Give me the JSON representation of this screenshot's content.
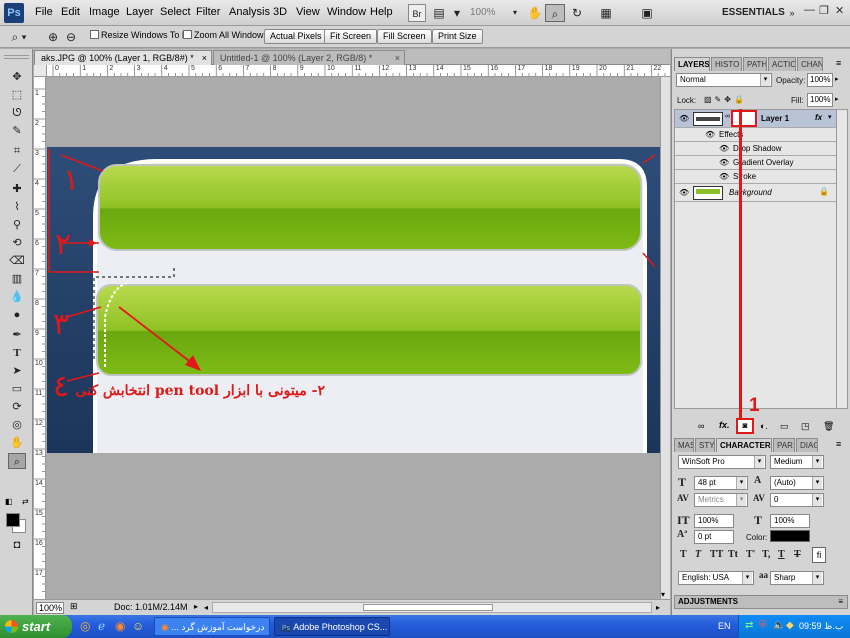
{
  "app": {
    "logo": "Ps"
  },
  "menu": [
    "File",
    "Edit",
    "Image",
    "Layer",
    "Select",
    "Filter",
    "Analysis",
    "3D",
    "View",
    "Window",
    "Help"
  ],
  "menubar": {
    "zoom": "100%",
    "workspace": "ESSENTIALS"
  },
  "options": {
    "resize_windows": "Resize Windows To Fit",
    "zoom_all": "Zoom All Windows",
    "actual_pixels": "Actual Pixels",
    "fit_screen": "Fit Screen",
    "fill_screen": "Fill Screen",
    "print_size": "Print Size"
  },
  "tabs": [
    {
      "label": "aks.JPG @ 100% (Layer 1, RGB/8#) *",
      "close": "×"
    },
    {
      "label": "Untitled-1 @ 100% (Layer 2, RGB/8) *",
      "close": "×"
    }
  ],
  "ruler": {
    "top": [
      "0",
      "1",
      "2",
      "3",
      "4",
      "5",
      "6",
      "7",
      "8",
      "9",
      "10",
      "11",
      "12",
      "13",
      "14",
      "15",
      "16",
      "17",
      "18",
      "19",
      "20",
      "21",
      "22"
    ],
    "left": [
      "1",
      "2",
      "3",
      "4",
      "5",
      "6",
      "7",
      "8",
      "9",
      "10",
      "11",
      "12",
      "13",
      "14",
      "15",
      "16",
      "17"
    ]
  },
  "annotations": {
    "n1": "١",
    "n2": "٢",
    "n3": "٣",
    "n4": "٤",
    "caption": "٢- میتونی با ابزار pen tool انتخابش کنی",
    "callout": "1"
  },
  "status": {
    "zoom": "100%",
    "doc": "Doc: 1.01M/2.14M"
  },
  "layers_panel": {
    "tabs": [
      "LAYERS",
      "HISTO",
      "PATH",
      "ACTIO",
      "CHAN"
    ],
    "blend_mode": "Normal",
    "opacity_label": "Opacity:",
    "opacity": "100%",
    "lock_label": "Lock:",
    "fill_label": "Fill:",
    "fill": "100%",
    "layers": [
      {
        "name": "Layer 1",
        "fx": "fx"
      },
      {
        "name": "Background"
      }
    ],
    "effects_label": "Effects",
    "effects": [
      "Drop Shadow",
      "Gradient Overlay",
      "Stroke"
    ]
  },
  "char_panel": {
    "tabs": [
      "MAS",
      "STY",
      "CHARACTER",
      "PAR",
      "DIAG"
    ],
    "font_family": "WinSoft Pro",
    "font_style": "Medium",
    "size": "48 pt",
    "leading": "(Auto)",
    "kerning": "Metrics",
    "tracking": "0",
    "vscale": "100%",
    "hscale": "100%",
    "baseline": "0 pt",
    "color_label": "Color:",
    "styles": [
      "T",
      "T",
      "TT",
      "Tt",
      "T'",
      "T,",
      "T",
      "T"
    ],
    "language": "English: USA",
    "aa_label": "a",
    "antialias": "Sharp"
  },
  "adjustments": {
    "label": "ADJUSTMENTS"
  },
  "taskbar": {
    "start": "start",
    "task1": "... درخواست آموزش گرد",
    "task2": "Adobe Photoshop CS...",
    "lang": "EN",
    "clock": "09:59 ب.ظ"
  }
}
